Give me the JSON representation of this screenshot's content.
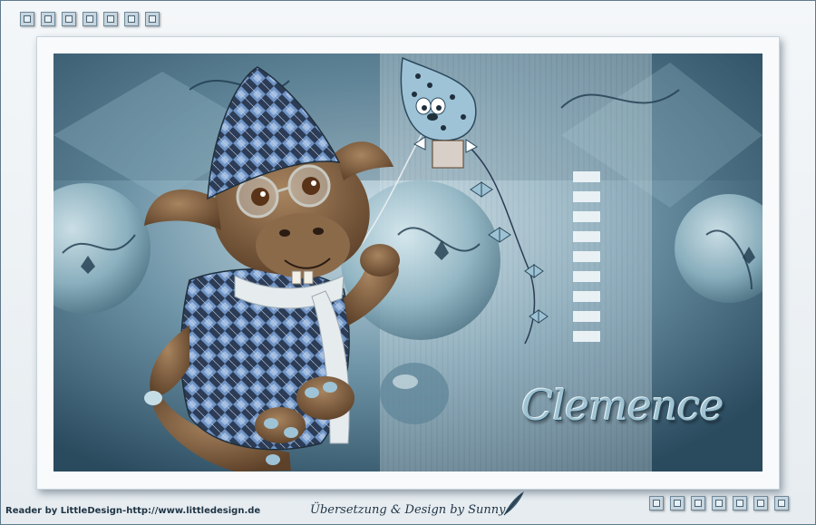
{
  "artwork": {
    "title": "Clemence",
    "deco_squares_top_count": 7,
    "deco_squares_bottom_count": 7,
    "palette": {
      "frame": "#5f7a8c",
      "dark_teal": "#2a4a5e",
      "mid_teal": "#6d93a6",
      "light_teal": "#b9d2dc",
      "creature_brown": "#7a5a3e"
    }
  },
  "credits": {
    "left": "Reader by LittleDesign-http://www.littledesign.de",
    "right": "Übersetzung & Design by Sunny"
  }
}
